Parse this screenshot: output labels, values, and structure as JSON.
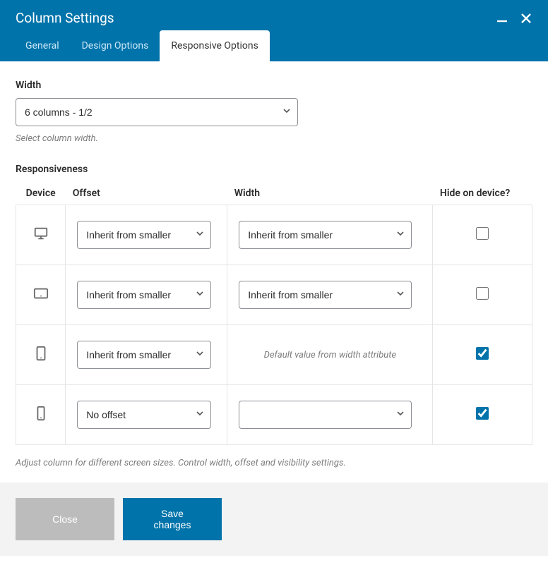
{
  "header": {
    "title": "Column Settings"
  },
  "tabs": {
    "general": "General",
    "design": "Design Options",
    "responsive": "Responsive Options"
  },
  "width": {
    "label": "Width",
    "value": "6 columns - 1/2",
    "helper": "Select column width."
  },
  "responsiveness": {
    "label": "Responsiveness",
    "columns": {
      "device": "Device",
      "offset": "Offset",
      "width": "Width",
      "hide": "Hide on device?"
    },
    "default_width_text": "Default value from width attribute",
    "rows": [
      {
        "offset": "Inherit from smaller",
        "width": "Inherit from smaller",
        "hide": false
      },
      {
        "offset": "Inherit from smaller",
        "width": "Inherit from smaller",
        "hide": false
      },
      {
        "offset": "Inherit from smaller",
        "width": "",
        "hide": true
      },
      {
        "offset": "No offset",
        "width": "",
        "hide": true
      }
    ],
    "helper": "Adjust column for different screen sizes. Control width, offset and visibility settings."
  },
  "footer": {
    "close": "Close",
    "save": "Save changes"
  }
}
